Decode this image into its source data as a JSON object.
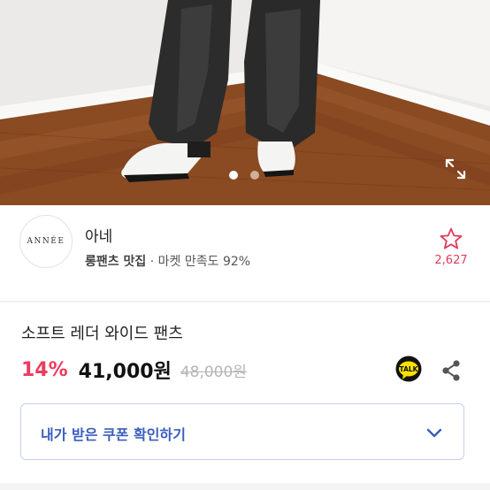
{
  "gallery": {
    "image_alt": "leather wide pants with white boots",
    "current_index": 1,
    "total": 2,
    "expand_icon": "expand-icon"
  },
  "store": {
    "logo_text": "ANNÉE",
    "name": "아네",
    "category": "롱팬츠 맛집",
    "separator": "·",
    "rating": "마켓 만족도 92%",
    "favorite_count": "2,627",
    "favorite_icon": "star-outline-icon",
    "accent_color": "#e23a5c"
  },
  "product": {
    "title": "소프트 레더 와이드 팬츠",
    "discount": "14%",
    "price": "41,000원",
    "original_price": "48,000원",
    "discount_color": "#ee3b60"
  },
  "actions": {
    "talk_label": "TALK",
    "talk_icon": "kakaotalk-icon",
    "share_icon": "share-icon"
  },
  "coupon": {
    "label": "내가 받은 쿠폰 확인하기",
    "chevron_icon": "chevron-down-icon",
    "color": "#3a5dbe"
  }
}
